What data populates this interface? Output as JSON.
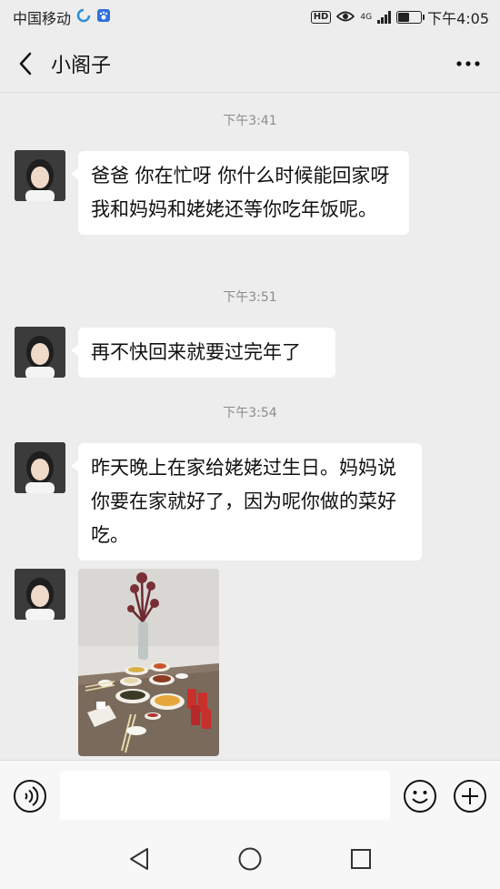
{
  "status_bar": {
    "carrier": "中国移动",
    "hd_badge": "HD",
    "network": "4G",
    "time": "下午4:05",
    "battery_level": 0.5
  },
  "header": {
    "title": "小阁子"
  },
  "messages": [
    {
      "type": "time",
      "text": "下午3:41"
    },
    {
      "type": "text",
      "text": "爸爸 你在忙呀 你什么时候能回家呀 我和妈妈和姥姥还等你吃年饭呢。"
    },
    {
      "type": "time",
      "text": "下午3:51"
    },
    {
      "type": "text",
      "text": "再不快回来就要过完年了"
    },
    {
      "type": "time",
      "text": "下午3:54"
    },
    {
      "type": "text",
      "text": "昨天晚上在家给姥姥过生日。妈妈说你要在家就好了，因为呢你做的菜好吃。"
    },
    {
      "type": "image"
    }
  ],
  "input_bar": {
    "placeholder": ""
  },
  "icons": {
    "back": "chevron-left-icon",
    "more": "more-dots-icon",
    "voice": "voice-icon",
    "emoji": "emoji-icon",
    "plus": "plus-icon"
  },
  "colors": {
    "background": "#ededed",
    "bubble": "#ffffff",
    "time_label": "#8c8c8c"
  }
}
